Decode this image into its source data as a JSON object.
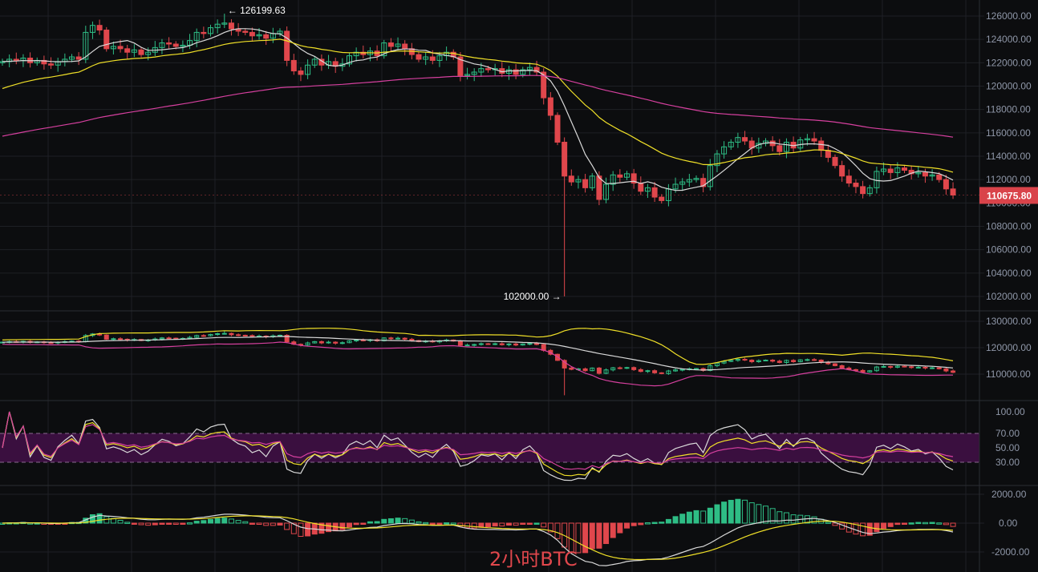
{
  "chart_data": {
    "type": "candlestick",
    "title": "2小时BTC",
    "colors": {
      "up": "#2ebd85",
      "down": "#e0474c",
      "ma_fast": "#d9d9d9",
      "ma_mid": "#f0e028",
      "ma_slow": "#d6409f",
      "rsi_band": "#3a0f3f",
      "bg": "#0c0d0f",
      "grid": "#1e2025"
    },
    "first_open": 122000,
    "closes": [
      122100,
      122300,
      122200,
      122400,
      122000,
      122200,
      121900,
      121800,
      122100,
      122300,
      122500,
      122300,
      124600,
      125200,
      124800,
      123200,
      123400,
      123200,
      122900,
      123100,
      122700,
      122900,
      123300,
      123700,
      123600,
      123400,
      123500,
      123900,
      124600,
      124500,
      125000,
      125300,
      125400,
      124900,
      124700,
      124600,
      124300,
      124400,
      124100,
      124500,
      124700,
      122200,
      121300,
      121000,
      121800,
      122300,
      121800,
      122100,
      121700,
      121900,
      122600,
      122900,
      122700,
      123000,
      122600,
      123700,
      123400,
      123600,
      123200,
      122700,
      122300,
      122500,
      122200,
      122600,
      122900,
      122500,
      120900,
      121000,
      121200,
      121500,
      121400,
      121500,
      121100,
      121400,
      121000,
      121400,
      121600,
      121200,
      119000,
      117500,
      115200,
      112300,
      111800,
      112000,
      111300,
      112300,
      110300,
      111600,
      112400,
      112200,
      112500,
      111700,
      111000,
      111300,
      110500,
      110200,
      111200,
      111600,
      111800,
      112000,
      112100,
      111400,
      113200,
      114200,
      114800,
      115200,
      115600,
      115300,
      114700,
      115100,
      115300,
      114900,
      114400,
      115200,
      114700,
      115400,
      115500,
      115300,
      114500,
      113900,
      113200,
      112300,
      111700,
      111400,
      110800,
      111300,
      112700,
      112900,
      112600,
      113000,
      112800,
      112500,
      112600,
      112300,
      112400,
      112000,
      111200,
      110675.8
    ],
    "highest": {
      "value": 126199.63,
      "index": 32,
      "label": "126199.63"
    },
    "lowest": {
      "value": 102000.0,
      "index": 81,
      "label": "102000.00"
    },
    "last_price": {
      "value": 110675.8,
      "label": "110675.80"
    },
    "ma_mid_start": 119600,
    "ma_slow_start": 115600,
    "price_axis": {
      "ticks": [
        "126000.00",
        "124000.00",
        "122000.00",
        "120000.00",
        "118000.00",
        "116000.00",
        "114000.00",
        "112000.00",
        "110000.00",
        "108000.00",
        "106000.00",
        "104000.00",
        "102000.00"
      ],
      "range": [
        101000,
        127500
      ]
    },
    "boll_axis": {
      "ticks": [
        "130000.00",
        "120000.00",
        "110000.00"
      ]
    },
    "rsi_axis": {
      "ticks": [
        "100.00",
        "70.00",
        "50.00",
        "30.00"
      ],
      "band": [
        30,
        70
      ]
    },
    "macd_axis": {
      "ticks": [
        "2000.00",
        "0.00",
        "-2000.00"
      ]
    }
  }
}
